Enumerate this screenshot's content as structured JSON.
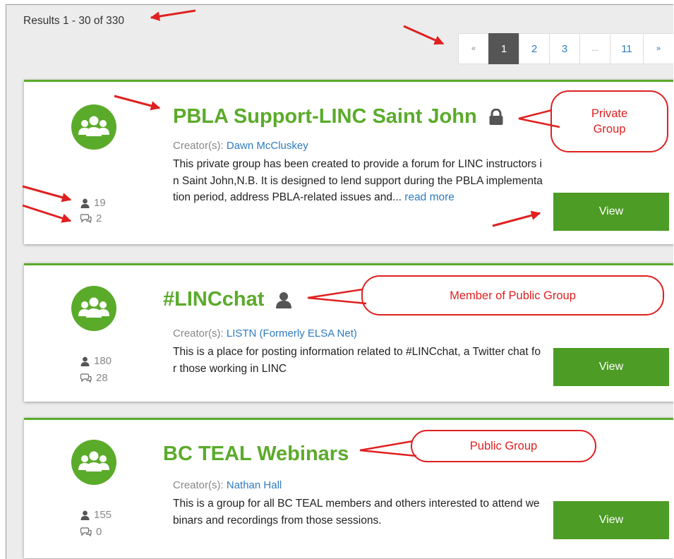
{
  "results_text": "Results 1 - 30 of 330",
  "pagination": {
    "prev": "«",
    "pages": [
      "1",
      "2",
      "3"
    ],
    "ellipsis": "...",
    "last": "11",
    "next": "»",
    "current": "1"
  },
  "groups": [
    {
      "title": "PBLA Support-LINC Saint John",
      "status_icon": "lock-icon",
      "creator_label": "Creator(s):",
      "creator": "Dawn McCluskey",
      "description": "This private group has been created to provide a forum for LINC instructors in Saint John,N.B. It is designed to lend support during the PBLA implementation period, address PBLA-related issues and...",
      "read_more": "read more",
      "members": "19",
      "discussions": "2",
      "view_label": "View",
      "annotation": "Private\nGroup"
    },
    {
      "title": "#LINCchat",
      "status_icon": "member-icon",
      "creator_label": "Creator(s):",
      "creator": "LISTN (Formerly ELSA Net)",
      "description": "This is a place for posting information related to #LINCchat, a Twitter chat for those working in LINC",
      "members": "180",
      "discussions": "28",
      "view_label": "View",
      "annotation": "Member of Public Group"
    },
    {
      "title": "BC TEAL Webinars",
      "creator_label": "Creator(s):",
      "creator": "Nathan Hall",
      "description": "This is a group for all BC TEAL members and others interested to attend webinars and recordings from those sessions.",
      "members": "155",
      "discussions": "0",
      "view_label": "View",
      "annotation": "Public Group"
    }
  ],
  "colors": {
    "accent_green": "#5bab2b",
    "button_green": "#4d9c25",
    "link_blue": "#2f7cc0",
    "annotation_red": "#e02020",
    "active_page": "#555555"
  }
}
